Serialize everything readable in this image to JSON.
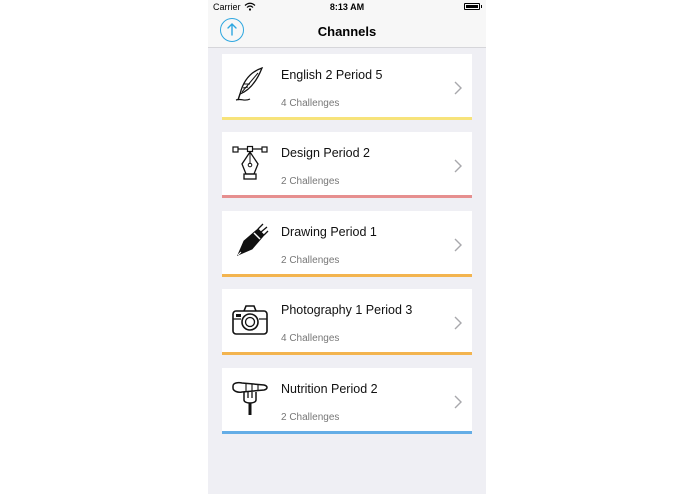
{
  "status_bar": {
    "carrier": "Carrier",
    "time": "8:13 AM"
  },
  "nav": {
    "title": "Channels",
    "left_icon": "upload-icon"
  },
  "colors": {
    "accent": "#2ea7e0"
  },
  "channels": [
    {
      "name": "English 2 Period 5",
      "subtitle": "4 Challenges",
      "icon": "quill-icon",
      "color": "#f7e37a"
    },
    {
      "name": "Design Period 2",
      "subtitle": "2 Challenges",
      "icon": "pen-tool-icon",
      "color": "#e68f8f"
    },
    {
      "name": "Drawing Period 1",
      "subtitle": "2 Challenges",
      "icon": "pencil-icon",
      "color": "#f3b44f"
    },
    {
      "name": "Photography 1 Period 3",
      "subtitle": "4 Challenges",
      "icon": "camera-icon",
      "color": "#f3b44f"
    },
    {
      "name": "Nutrition Period 2",
      "subtitle": "2 Challenges",
      "icon": "carrot-fork-icon",
      "color": "#64ade6"
    }
  ]
}
